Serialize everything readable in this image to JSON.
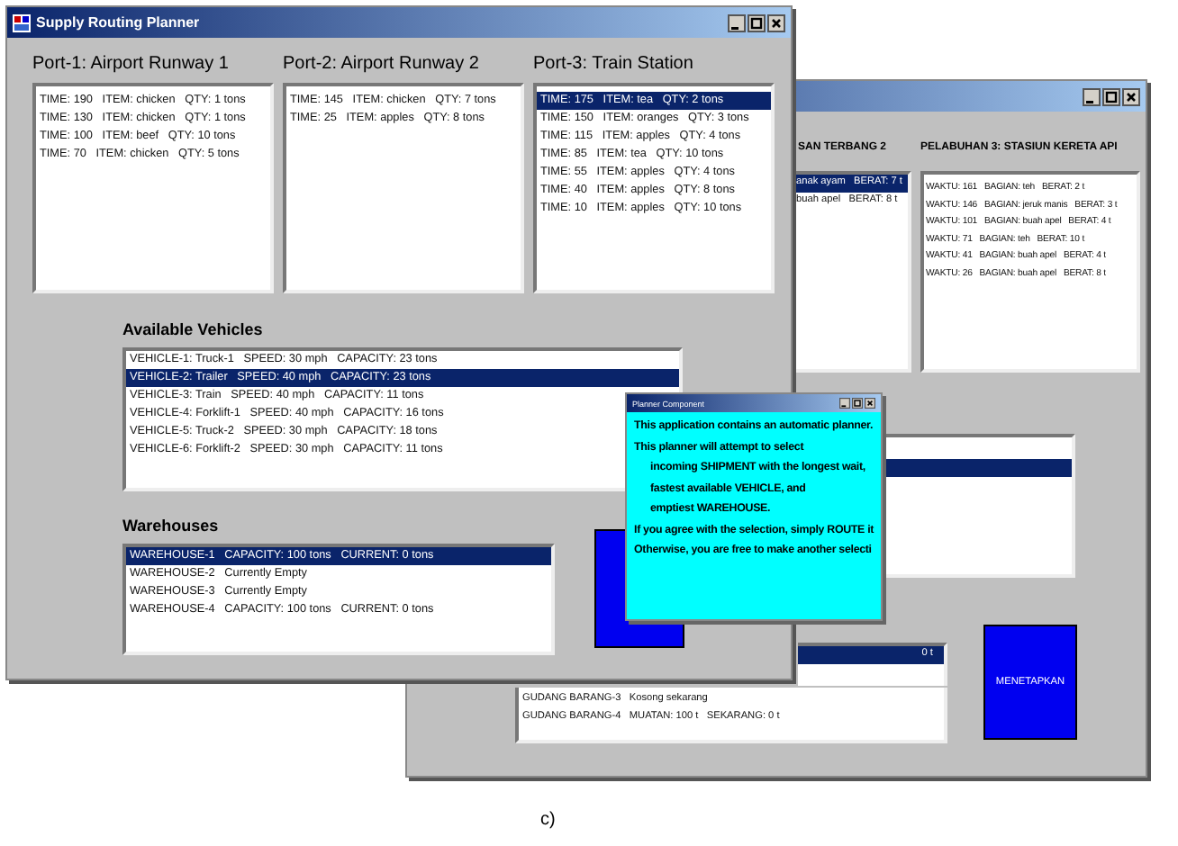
{
  "back_window": {
    "headings": [
      "SAN TERBANG 2",
      "PELABUHAN 3: STASIUN KERETA API"
    ],
    "port_2_rows": [
      {
        "text": "anak ayam   BERAT: 7 t",
        "selected": true
      },
      {
        "text": "buah apel   BERAT: 8 t",
        "selected": false
      }
    ],
    "port_3_rows": [
      {
        "text": "WAKTU: 161   BAGIAN: teh   BERAT: 2 t",
        "selected": false
      },
      {
        "text": "WAKTU: 146   BAGIAN: jeruk manis   BERAT: 3 t",
        "selected": false
      },
      {
        "text": "WAKTU: 101   BAGIAN: buah apel   BERAT: 4 t",
        "selected": false
      },
      {
        "text": "WAKTU: 71   BAGIAN: teh   BERAT: 10 t",
        "selected": false
      },
      {
        "text": "WAKTU: 41   BAGIAN: buah apel   BERAT: 4 t",
        "selected": false
      },
      {
        "text": "WAKTU: 26   BAGIAN: buah apel   BERAT: 8 t",
        "selected": false
      }
    ],
    "middle_list_rows": [
      {
        "selected": true
      }
    ],
    "warehouse_rows": [
      {
        "text": "0 t",
        "selected": true
      },
      {
        "text": "GUDANG BARANG-3   Kosong sekarang",
        "selected": false
      },
      {
        "text": "GUDANG BARANG-4   MUATAN: 100 t   SEKARANG: 0 t",
        "selected": false
      }
    ],
    "button": "MENETAPKAN"
  },
  "main_window": {
    "title": "Supply Routing Planner",
    "ports": [
      {
        "heading": "Port-1: Airport Runway 1",
        "rows": [
          {
            "text": "TIME: 190   ITEM: chicken   QTY: 1 tons",
            "selected": false
          },
          {
            "text": "TIME: 130   ITEM: chicken   QTY: 1 tons",
            "selected": false
          },
          {
            "text": "TIME: 100   ITEM: beef   QTY: 10 tons",
            "selected": false
          },
          {
            "text": "TIME: 70   ITEM: chicken   QTY: 5 tons",
            "selected": false
          }
        ]
      },
      {
        "heading": "Port-2: Airport Runway 2",
        "rows": [
          {
            "text": "TIME: 145   ITEM: chicken   QTY: 7 tons",
            "selected": false
          },
          {
            "text": "TIME: 25   ITEM: apples   QTY: 8 tons",
            "selected": false
          }
        ]
      },
      {
        "heading": "Port-3: Train Station",
        "rows": [
          {
            "text": "TIME: 175   ITEM: tea   QTY: 2 tons",
            "selected": true
          },
          {
            "text": "TIME: 150   ITEM: oranges   QTY: 3 tons",
            "selected": false
          },
          {
            "text": "TIME: 115   ITEM: apples   QTY: 4 tons",
            "selected": false
          },
          {
            "text": "TIME: 85   ITEM: tea   QTY: 10 tons",
            "selected": false
          },
          {
            "text": "TIME: 55   ITEM: apples   QTY: 4 tons",
            "selected": false
          },
          {
            "text": "TIME: 40   ITEM: apples   QTY: 8 tons",
            "selected": false
          },
          {
            "text": "TIME: 10   ITEM: apples   QTY: 10 tons",
            "selected": false
          }
        ]
      }
    ],
    "vehicles_heading": "Available Vehicles",
    "vehicles": [
      {
        "text": "VEHICLE-1: Truck-1   SPEED: 30 mph   CAPACITY: 23 tons",
        "selected": false
      },
      {
        "text": "VEHICLE-2: Trailer   SPEED: 40 mph   CAPACITY: 23 tons",
        "selected": true
      },
      {
        "text": "VEHICLE-3: Train   SPEED: 40 mph   CAPACITY: 11 tons",
        "selected": false
      },
      {
        "text": "VEHICLE-4: Forklift-1   SPEED: 40 mph   CAPACITY: 16 tons",
        "selected": false
      },
      {
        "text": "VEHICLE-5: Truck-2   SPEED: 30 mph   CAPACITY: 18 tons",
        "selected": false
      },
      {
        "text": "VEHICLE-6: Forklift-2   SPEED: 30 mph   CAPACITY: 11 tons",
        "selected": false
      }
    ],
    "warehouses_heading": "Warehouses",
    "warehouses": [
      {
        "text": "WAREHOUSE-1   CAPACITY: 100 tons   CURRENT: 0 tons",
        "selected": true
      },
      {
        "text": "WAREHOUSE-2   Currently Empty",
        "selected": false
      },
      {
        "text": "WAREHOUSE-3   Currently Empty",
        "selected": false
      },
      {
        "text": "WAREHOUSE-4   CAPACITY: 100 tons   CURRENT: 0 tons",
        "selected": false
      }
    ]
  },
  "dialog": {
    "title": "Planner Component",
    "lines": [
      {
        "text": "This application contains an automatic planner.",
        "indented": false
      },
      {
        "text": "This planner will attempt to select",
        "indented": false
      },
      {
        "text": "incoming SHIPMENT with the longest wait,",
        "indented": true
      },
      {
        "text": "fastest available VEHICLE, and",
        "indented": true
      },
      {
        "text": "emptiest WAREHOUSE.",
        "indented": true
      },
      {
        "text": "If you agree with the selection, simply ROUTE it",
        "indented": false
      },
      {
        "text": "Otherwise, you are free to make another selecti",
        "indented": false
      }
    ]
  },
  "caption": "c)"
}
